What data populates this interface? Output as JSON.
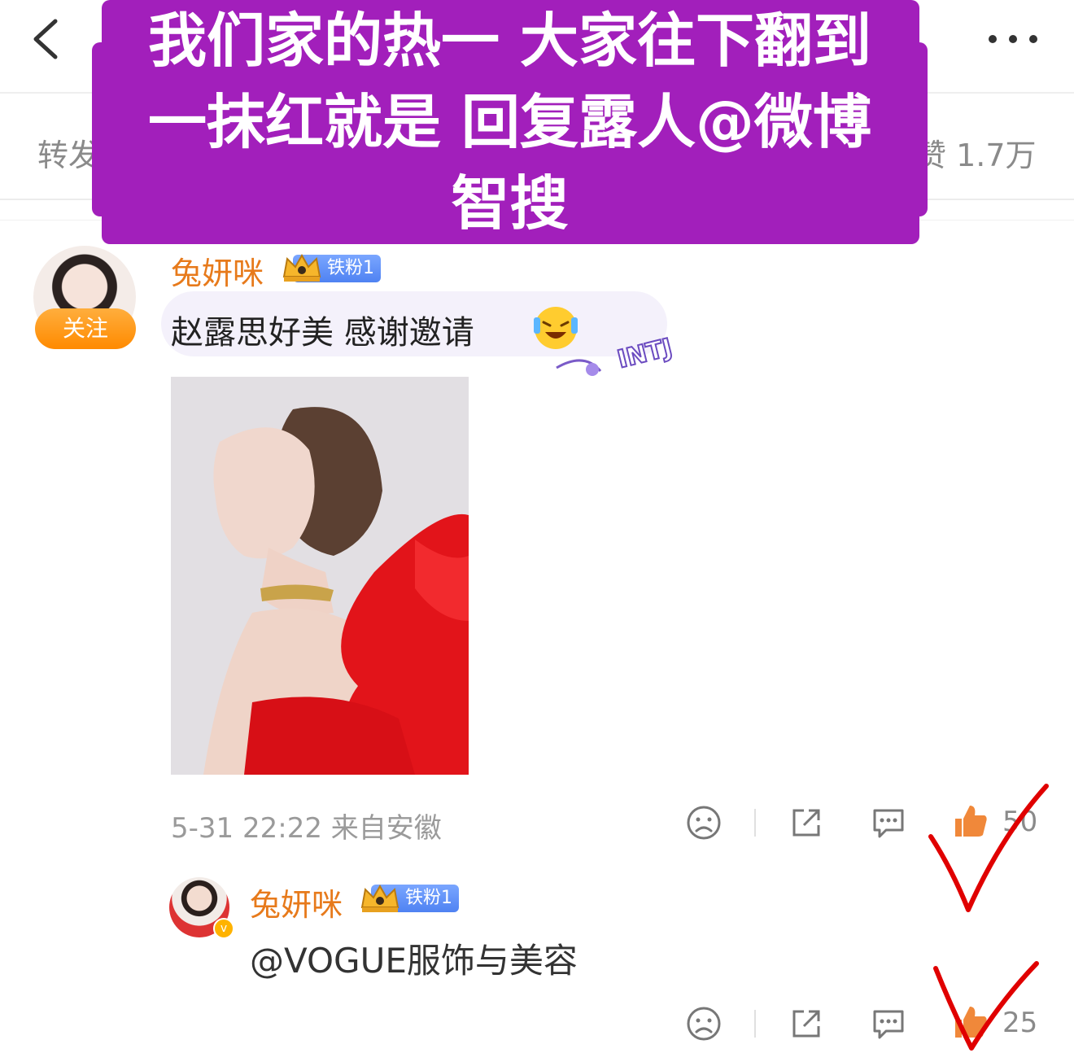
{
  "header": {
    "left_tab": "转发",
    "right_tab": "赞 1.7万"
  },
  "banner": {
    "lines": [
      "我们家的热一 大家往下翻到",
      "一抹红就是 回复露人@微博",
      "智搜"
    ]
  },
  "comment": {
    "follow_label": "关注",
    "username": "兔妍咪",
    "fan_badge": "铁粉1",
    "text": "赵露思好美 感谢邀请",
    "sticker_text": "INTJ",
    "timestamp": "5-31 22:22 来自安徽",
    "like_count": "50"
  },
  "reply": {
    "username": "兔妍咪",
    "fan_badge": "铁粉1",
    "text": "@VOGUE服饰与美容",
    "like_count": "25"
  },
  "icons": [
    "back-icon",
    "more-icon",
    "dislike-icon",
    "share-icon",
    "reply-icon",
    "thumbs-up-icon"
  ],
  "colors": {
    "banner": "#a21fbb",
    "username": "#e77a1b",
    "follow": "#ff9a1a",
    "checkmark": "#e00000"
  }
}
